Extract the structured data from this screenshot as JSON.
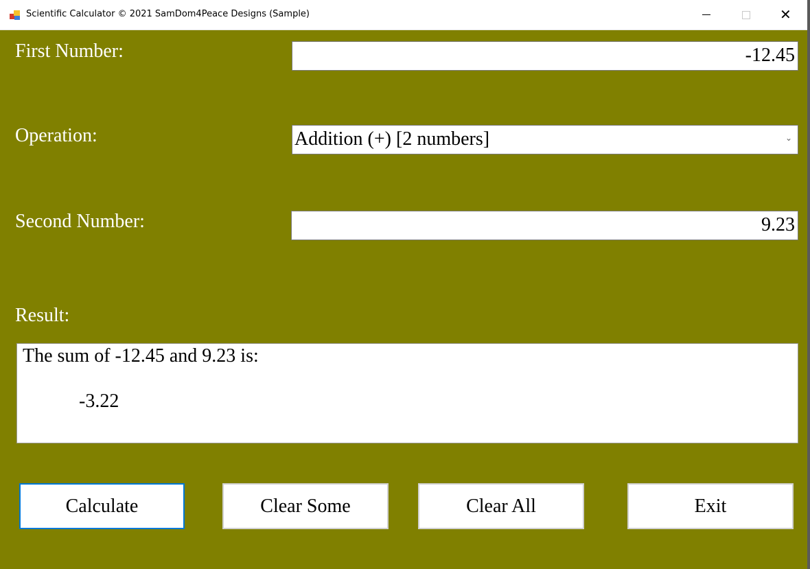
{
  "window": {
    "title": "Scientific Calculator © 2021 SamDom4Peace Designs (Sample)",
    "app_icon": "windows-forms-app-icon",
    "controls": {
      "minimize": "minimize-icon",
      "maximize": "maximize-icon",
      "close": "close-icon",
      "close_glyph": "✕"
    }
  },
  "theme": {
    "background": "#808000",
    "label_color": "#ffffff",
    "focus_color": "#0078d7"
  },
  "form": {
    "first_number": {
      "label": "First Number:",
      "value": "-12.45"
    },
    "operation": {
      "label": "Operation:",
      "selected": "Addition (+) [2 numbers]",
      "arrow": "⌄"
    },
    "second_number": {
      "label": "Second Number:",
      "value": "9.23"
    },
    "result": {
      "label": "Result:",
      "line1": "The sum of -12.45 and 9.23 is:",
      "line2": "-3.22"
    }
  },
  "buttons": {
    "calculate": "Calculate",
    "clear_some": "Clear Some",
    "clear_all": "Clear All",
    "exit": "Exit"
  }
}
